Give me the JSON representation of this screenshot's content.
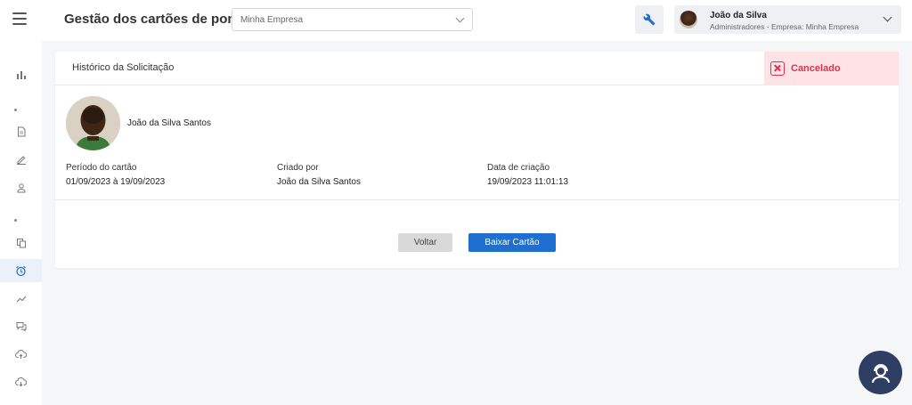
{
  "header": {
    "title": "Gestão dos cartões de ponto",
    "company_select": {
      "value": "Minha Empresa"
    },
    "tool_icon": "wrench-icon",
    "user": {
      "name": "João da Silva",
      "role": "Administradores - Empresa: Minha Empresa"
    }
  },
  "sidebar": {
    "items": [
      {
        "icon": "bar-chart-icon"
      },
      {
        "icon": "document-icon"
      },
      {
        "icon": "edit-icon"
      },
      {
        "icon": "user-icon"
      },
      {
        "icon": "copy-icon"
      },
      {
        "icon": "alarm-clock-icon",
        "active": true
      },
      {
        "icon": "trend-line-icon"
      },
      {
        "icon": "chat-icon"
      },
      {
        "icon": "cloud-upload-icon"
      },
      {
        "icon": "cloud-download-icon"
      }
    ]
  },
  "card": {
    "title": "Histórico da Solicitação",
    "status": {
      "label": "Cancelado",
      "color": "#d9344f",
      "background": "#fde2e6"
    },
    "person": {
      "name": "João da Silva Santos"
    },
    "fields": [
      {
        "label": "Período do cartão",
        "value": "01/09/2023 à 19/09/2023"
      },
      {
        "label": "Criado por",
        "value": "João da Silva Santos"
      },
      {
        "label": "Data de criação",
        "value": "19/09/2023 11:01:13"
      }
    ],
    "buttons": {
      "back": "Voltar",
      "download": "Baixar Cartão"
    }
  },
  "colors": {
    "primary": "#1f6fd1",
    "help_button": "#2e3f63"
  }
}
